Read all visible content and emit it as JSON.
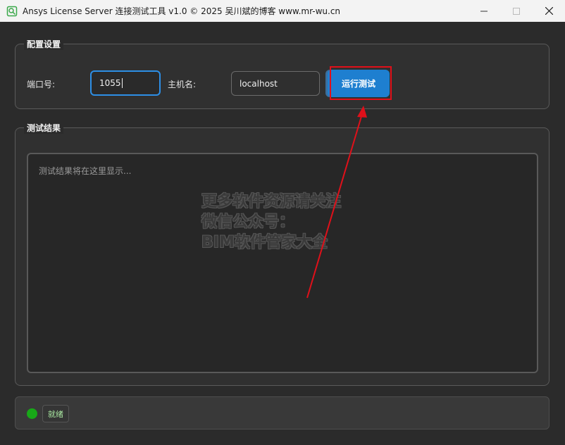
{
  "window": {
    "title": "Ansys License Server 连接测试工具 v1.0 © 2025 吴川斌的博客 www.mr-wu.cn",
    "minimize_icon": "minimize-icon",
    "maximize_icon": "maximize-icon",
    "close_icon": "close-icon",
    "app_icon": "app-icon"
  },
  "config": {
    "group_title": "配置设置",
    "port_label": "端口号:",
    "port_value": "1055",
    "host_label": "主机名:",
    "host_value": "localhost",
    "run_button_label": "运行测试"
  },
  "results": {
    "group_title": "测试结果",
    "placeholder": "测试结果将在这里显示..."
  },
  "watermark": {
    "line1": "更多软件资源请关注",
    "line2": "微信公众号：",
    "line3": "BIM软件管家大全"
  },
  "status": {
    "text": "就绪",
    "indicator_color": "#18a818"
  },
  "colors": {
    "accent": "#1e7fd0",
    "highlight": "#e0101a",
    "annotation_arrow": "#e0101a"
  }
}
